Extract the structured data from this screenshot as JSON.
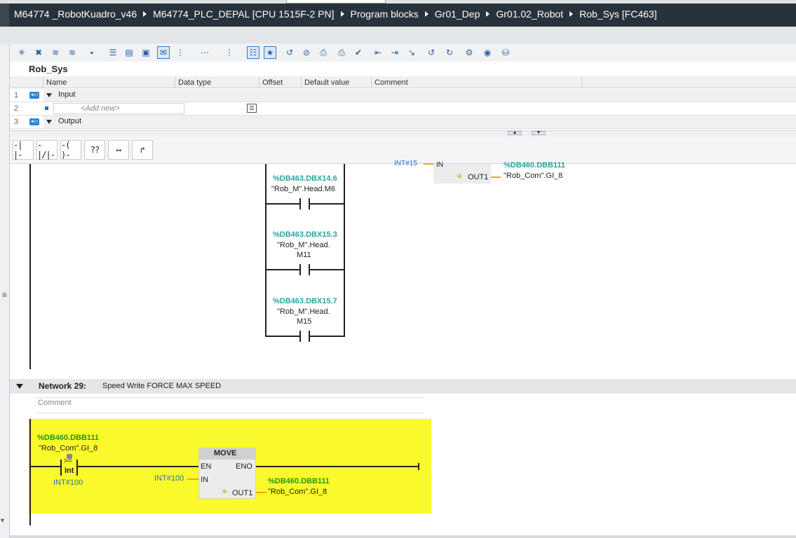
{
  "breadcrumb": [
    "M64774 _RobotKuadro_v46",
    "M64774_PLC_DEPAL [CPU 1515F-2 PN]",
    "Program blocks",
    "Gr01_Dep",
    "Gr01.02_Robot",
    "Rob_Sys [FC463]"
  ],
  "block": {
    "title": "Rob_Sys",
    "columns": [
      "Name",
      "Data type",
      "Offset",
      "Default value",
      "Comment"
    ],
    "rows": [
      {
        "num": "1",
        "name": "Input"
      },
      {
        "num": "2",
        "name": "<Add new>"
      },
      {
        "num": "3",
        "name": "Output"
      }
    ]
  },
  "ladder_toolbar": [
    "-| |-",
    "-|/|-",
    "-( )-",
    "??",
    "↦",
    "↱"
  ],
  "prev_network": {
    "in_label_partial": "INT#15",
    "move_pin_in": "IN",
    "move_pin_out": "OUT1",
    "out_addr": "%DB460.DBB111",
    "out_sym": "\"Rob_Com\".GI_8",
    "contacts": [
      {
        "addr": "%DB463.DBX14.6",
        "sym1": "\"Rob_M\".Head.M6",
        "sym2": ""
      },
      {
        "addr": "%DB463.DBX15.3",
        "sym1": "\"Rob_M\".Head.",
        "sym2": "M11"
      },
      {
        "addr": "%DB463.DBX15.7",
        "sym1": "\"Rob_M\".Head.",
        "sym2": "M15"
      }
    ]
  },
  "network29": {
    "label": "Network 29:",
    "title": "Speed Write FORCE MAX SPEED",
    "comment_placeholder": "Comment",
    "cmp_addr": "%DB460.DBB111",
    "cmp_sym": "\"Rob_Com\".GI_8",
    "cmp_op": ">=",
    "cmp_type": "Int",
    "cmp_value": "INT#100",
    "move_title": "MOVE",
    "move_en": "EN",
    "move_eno": "ENO",
    "move_in": "IN",
    "move_out": "OUT1",
    "move_in_value": "INT#100",
    "out_addr": "%DB460.DBB111",
    "out_sym": "\"Rob_Com\".GI_8"
  },
  "colors": {
    "highlight": "#fafa2a",
    "wire": "#222222",
    "pin": "#f0a020",
    "addr_teal": "#2aa4a4",
    "addr_green": "#1f9a1f"
  }
}
